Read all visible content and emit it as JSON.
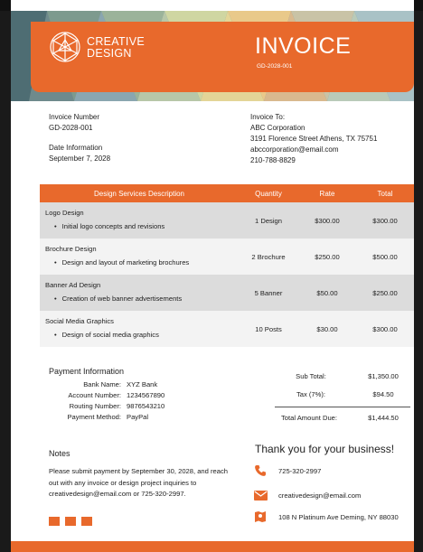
{
  "brand": {
    "line1": "CREATIVE",
    "line2": "DESIGN"
  },
  "invoice": {
    "title": "INVOICE",
    "number_sub": "GD-2028-001"
  },
  "left_info": {
    "number_label": "Invoice Number",
    "number_value": "GD-2028-001",
    "date_label": "Date Information",
    "date_value": "September 7, 2028"
  },
  "bill_to": {
    "label": "Invoice To:",
    "company": "ABC Corporation",
    "address": "3191 Florence Street Athens, TX 75751",
    "email": "abccorporation@email.com",
    "phone": "210-788-8829"
  },
  "table": {
    "headers": [
      "Design Services Description",
      "Quantity",
      "Rate",
      "Total"
    ],
    "rows": [
      {
        "title": "Logo Design",
        "detail": "Initial logo concepts and revisions",
        "quantity": "1 Design",
        "rate": "$300.00",
        "total": "$300.00"
      },
      {
        "title": "Brochure Design",
        "detail": "Design and layout of marketing brochures",
        "quantity": "2 Brochure",
        "rate": "$250.00",
        "total": "$500.00"
      },
      {
        "title": "Banner Ad Design",
        "detail": "Creation of web banner advertisements",
        "quantity": "5 Banner",
        "rate": "$50.00",
        "total": "$250.00"
      },
      {
        "title": "Social Media Graphics",
        "detail": "Design of social media graphics",
        "quantity": "10 Posts",
        "rate": "$30.00",
        "total": "$300.00"
      }
    ]
  },
  "payment": {
    "title": "Payment Information",
    "bank_label": "Bank Name:",
    "bank_value": "XYZ Bank",
    "account_label": "Account Number:",
    "account_value": "1234567890",
    "routing_label": "Routing Number:",
    "routing_value": "9876543210",
    "method_label": "Payment Method:",
    "method_value": "PayPal"
  },
  "summary": {
    "subtotal_label": "Sub Total:",
    "subtotal_value": "$1,350.00",
    "tax_label": "Tax (7%):",
    "tax_value": "$94.50",
    "total_label": "Total Amount Due:",
    "total_value": "$1,444.50"
  },
  "notes": {
    "title": "Notes",
    "body": "Please submit payment by September 30, 2028, and reach out with any invoice or design project inquiries to creativedesign@email.com or 725-320-2997."
  },
  "thanks": "Thank you for your business!",
  "contact": {
    "phone": "725-320-2997",
    "email": "creativedesign@email.com",
    "address": "108 N Platinum Ave Deming, NY 88030"
  },
  "colors": {
    "accent": "#e8692c",
    "row_dark": "#dcdcdc",
    "row_light": "#f3f3f3"
  },
  "icons": {
    "logo": "globe-network-icon",
    "phone": "phone-icon",
    "email": "envelope-icon",
    "address": "map-pin-icon"
  }
}
